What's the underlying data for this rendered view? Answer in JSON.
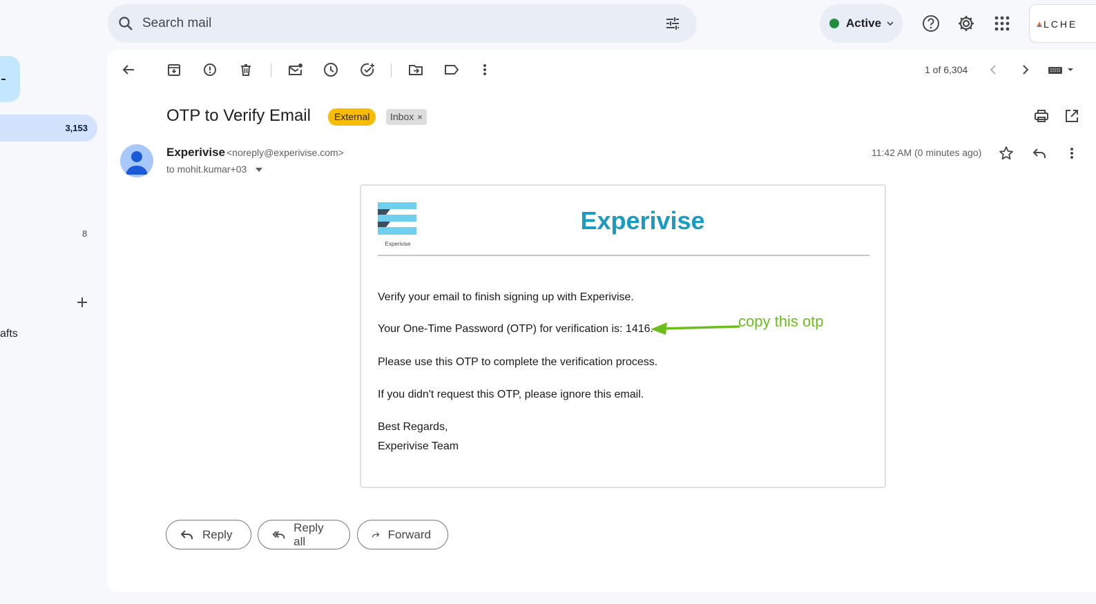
{
  "search": {
    "placeholder": "Search mail"
  },
  "status": {
    "label": "Active",
    "color": "#1e8e3e"
  },
  "account": {
    "logo_text": "LCHE"
  },
  "sidebar": {
    "inbox_count": "3,153",
    "other_count": "8",
    "drafts_label": "afts"
  },
  "toolbar": {
    "pager": "1 of 6,304"
  },
  "email": {
    "subject": "OTP to Verify Email",
    "badge_external": "External",
    "badge_inbox": "Inbox",
    "badge_inbox_close": "×",
    "sender_name": "Experivise",
    "sender_email": "<noreply@experivise.com>",
    "to_line": "to mohit.kumar+03",
    "timestamp": "11:42 AM (0 minutes ago)"
  },
  "card": {
    "logo_caption": "Experivise",
    "brand_title": "Experivise",
    "lines": [
      "Verify your email to finish signing up with Experivise.",
      "Your One-Time Password (OTP) for verification is: 1416.",
      "Please use this OTP to complete the verification process.",
      "If you didn't request this OTP, please ignore this email.",
      "Best Regards,",
      "Experivise Team"
    ],
    "annotation": "copy this otp",
    "brand_color": "#1a9bc2",
    "annotation_color": "#6dbd1f"
  },
  "actions": {
    "reply": "Reply",
    "reply_all": "Reply all",
    "forward": "Forward"
  }
}
